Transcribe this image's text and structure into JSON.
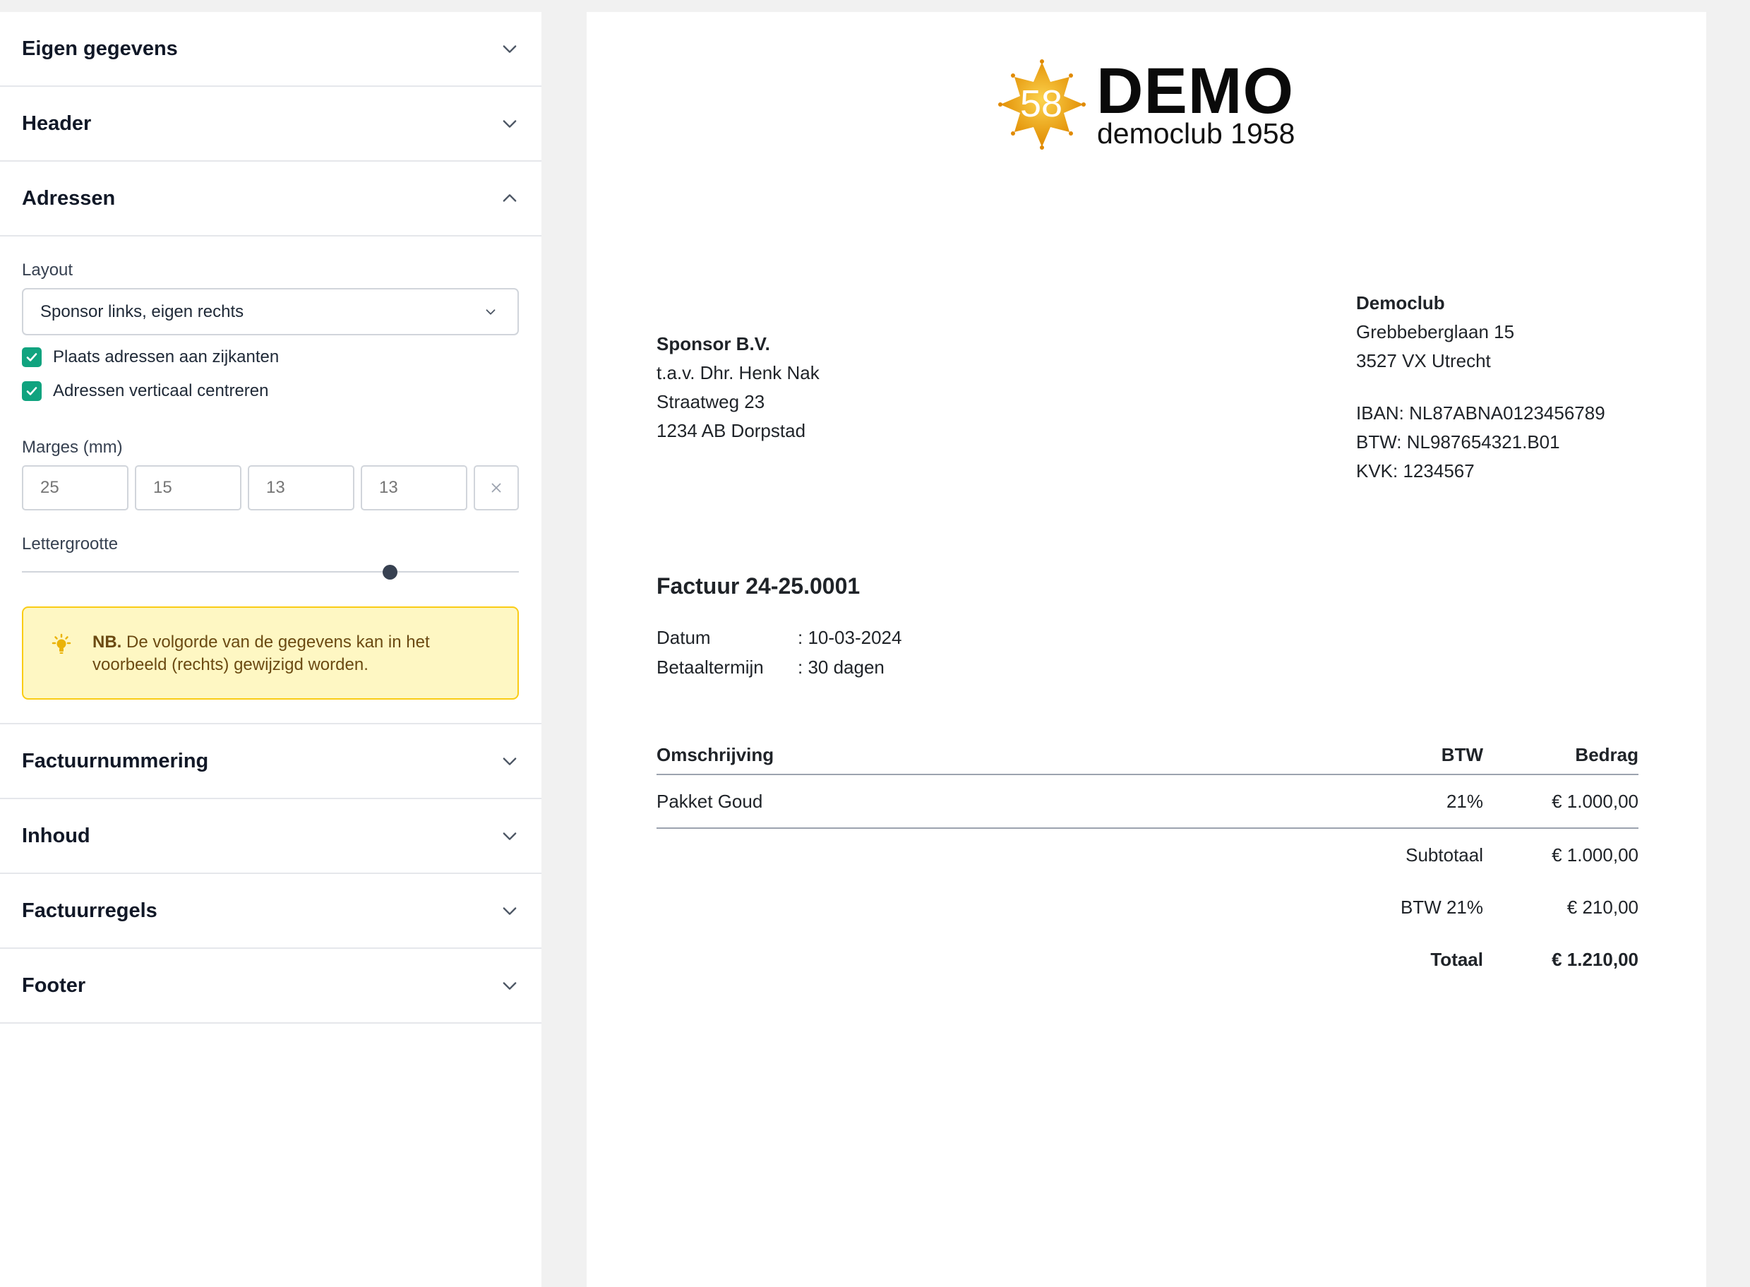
{
  "sidebar": {
    "sections": [
      {
        "title": "Eigen gegevens",
        "expanded": false
      },
      {
        "title": "Header",
        "expanded": false
      },
      {
        "title": "Adressen",
        "expanded": true
      },
      {
        "title": "Factuurnummering",
        "expanded": false
      },
      {
        "title": "Inhoud",
        "expanded": false
      },
      {
        "title": "Factuurregels",
        "expanded": false
      },
      {
        "title": "Footer",
        "expanded": false
      }
    ],
    "adressen": {
      "layout_label": "Layout",
      "layout_value": "Sponsor links, eigen rechts",
      "check_sides": "Plaats adressen aan zijkanten",
      "check_center": "Adressen verticaal centreren",
      "margins_label": "Marges (mm)",
      "margins": [
        "25",
        "15",
        "13",
        "13"
      ],
      "font_size_label": "Lettergrootte",
      "font_size_level": 0.74,
      "notice_bold": "NB.",
      "notice_text": " De volgorde van de gegevens kan in het voorbeeld (rechts) gewijzigd worden."
    }
  },
  "preview": {
    "logo": {
      "number": "58",
      "title": "DEMO",
      "subtitle": "democlub 1958"
    },
    "recipient": [
      "Sponsor B.V.",
      "t.a.v. Dhr. Henk Nak",
      "Straatweg 23",
      "1234 AB Dorpstad"
    ],
    "sender": {
      "name": "Democlub",
      "lines": [
        "Grebbeberglaan 15",
        "3527 VX Utrecht"
      ],
      "ids": [
        "IBAN: NL87ABNA0123456789",
        "BTW: NL987654321.B01",
        "KVK: 1234567"
      ]
    },
    "invoice_title": "Factuur 24-25.0001",
    "meta": [
      {
        "key": "Datum",
        "value": ": 10-03-2024"
      },
      {
        "key": "Betaaltermijn",
        "value": ": 30 dagen"
      }
    ],
    "table": {
      "headers": [
        "Omschrijving",
        "BTW",
        "Bedrag"
      ],
      "rows": [
        {
          "desc": "Pakket Goud",
          "btw": "21%",
          "amount": "€ 1.000,00"
        }
      ],
      "summary": [
        {
          "label": "Subtotaal",
          "value": "€ 1.000,00"
        },
        {
          "label": "BTW 21%",
          "value": "€ 210,00"
        },
        {
          "label": "Totaal",
          "value": "€ 1.210,00"
        }
      ]
    }
  },
  "colors": {
    "check": "#10a37f",
    "notice_bg": "#fef7c3",
    "notice_border": "#facc15",
    "logo_orange": "#f59e0b"
  }
}
